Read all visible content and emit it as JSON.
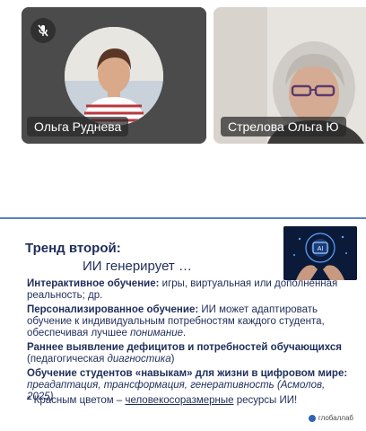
{
  "participants": [
    {
      "name": "Ольга Руднева",
      "mic": "mic-off-icon"
    },
    {
      "name": "Стрелова Ольга Ю"
    }
  ],
  "slide": {
    "title": "Тренд второй:",
    "subtitle": "ИИ генерирует …",
    "bullets": {
      "b1_bold": "Интерактивное обучение:",
      "b1_text": "игры, виртуальная или дополненная реальность; др.",
      "b2_bold": "Персонализированное обучение:",
      "b2_text1": "ИИ может адаптировать обучение к индивидуальным потребностям каждого студента, обеспечивая лучшее",
      "b2_italic": "понимание",
      "b2_end": ".",
      "b3_bold": "Раннее выявление дефицитов и потребностей обучающихся",
      "b3_paren_open": "(педагогическая",
      "b3_italic": "диагностика",
      "b3_paren_close": ")",
      "b4_bold": "Обучение студентов «навыкам» для жизни в цифровом мире:",
      "b4_italic": "преадаптация, трансформация, генеративность",
      "b4_cite": "(Асмолов, 2025)"
    },
    "footnote": {
      "prefix": "* Красным цветом –",
      "underlined": "человекосоразмерные",
      "suffix": "ресурсы ИИ!"
    },
    "brand": "глобаллаб"
  },
  "colors": {
    "slide_text": "#1f2d5a",
    "accent_red": "#c0392b",
    "slide_border": "#5b7fbf"
  }
}
